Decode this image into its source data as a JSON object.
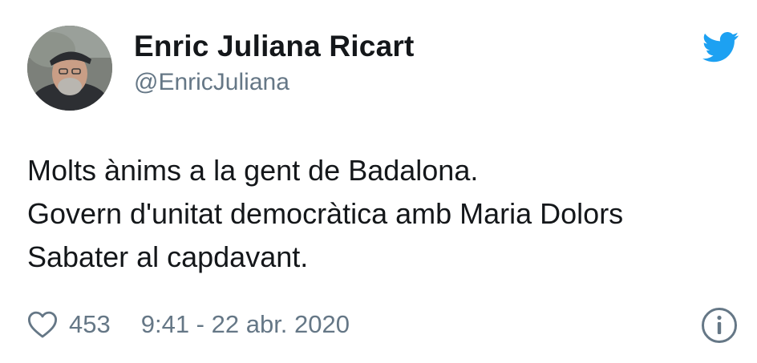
{
  "author": {
    "display_name": "Enric Juliana Ricart",
    "handle": "@EnricJuliana"
  },
  "tweet": {
    "lines": [
      "Molts ànims a la gent de Badalona.",
      "Govern d'unitat democràtica amb Maria Dolors",
      "Sabater al capdavant."
    ]
  },
  "footer": {
    "like_count": "453",
    "timestamp": "9:41 - 22 abr. 2020"
  },
  "icons": {
    "brand": "twitter-bird-icon",
    "like": "heart-icon",
    "info": "info-icon"
  },
  "colors": {
    "brand_blue": "#1da1f2",
    "secondary_text": "#657786",
    "primary_text": "#14171a"
  }
}
